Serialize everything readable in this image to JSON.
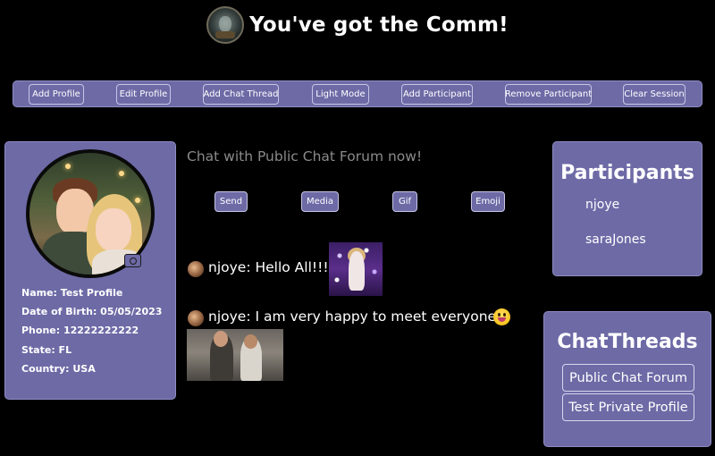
{
  "header": {
    "title": "You've got the Comm!",
    "logo_icon": "shield-emblem-icon"
  },
  "toolbar": {
    "buttons": [
      "Add Profile",
      "Edit Profile",
      "Add Chat Thread",
      "Light Mode",
      "Add Participant",
      "Remove Participant",
      "Clear Session"
    ]
  },
  "profile": {
    "avatar_icon": "profile-avatar-couple-image",
    "camera_icon": "camera-icon",
    "lines": [
      "Name: Test Profile",
      "Date of Birth: 05/05/2023",
      "Phone: 12222222222",
      "State: FL",
      "Country: USA"
    ]
  },
  "chat": {
    "heading": "Chat with Public Chat Forum now!",
    "actions": [
      "Send",
      "Media",
      "Gif",
      "Emoji"
    ],
    "messages": [
      {
        "text": "njoye: Hello All!!!",
        "attachment": "party-gif-image"
      },
      {
        "text": "njoye: I am very happy to meet everyone",
        "emoji": "smiling-face-tongue-icon",
        "attachment": "office-gif-image"
      }
    ]
  },
  "participants": {
    "title": "Participants",
    "names": [
      "njoye",
      "saraJones"
    ]
  },
  "threads": {
    "title": "ChatThreads",
    "items": [
      "Public Chat Forum",
      "Test Private Profile"
    ]
  },
  "colors": {
    "background": "#000000",
    "panel": "#6d6aa6",
    "panel_border": "#8f8cc4",
    "muted_text": "#8a8a8a"
  }
}
